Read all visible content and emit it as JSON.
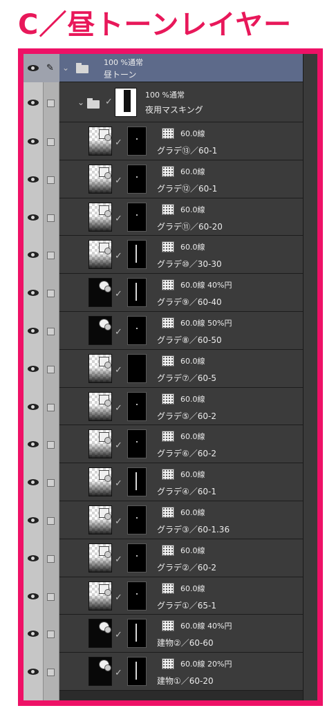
{
  "title": "C／昼トーンレイヤー",
  "top_folder": {
    "line1": "100 %通常",
    "line2": "昼トーン"
  },
  "sub_folder": {
    "line1": "100 %通常",
    "line2": "夜用マスキング"
  },
  "layers": [
    {
      "info": "60.0線",
      "name": "グラデ⑬／60-1",
      "thumb": "grad",
      "mask": "dot"
    },
    {
      "info": "60.0線",
      "name": "グラデ⑫／60-1",
      "thumb": "grad",
      "mask": "dot"
    },
    {
      "info": "60.0線",
      "name": "グラデ⑪／60-20",
      "thumb": "grad",
      "mask": "dot"
    },
    {
      "info": "60.0線",
      "name": "グラデ⑩／30-30",
      "thumb": "grad",
      "mask": "streak"
    },
    {
      "info": "60.0線 40%円",
      "name": "グラデ⑨／60-40",
      "thumb": "dark",
      "mask": "streak"
    },
    {
      "info": "60.0線 50%円",
      "name": "グラデ⑧／60-50",
      "thumb": "dark",
      "mask": "dot"
    },
    {
      "info": "60.0線",
      "name": "グラデ⑦／60-5",
      "thumb": "grad",
      "mask": "none"
    },
    {
      "info": "60.0線",
      "name": "グラデ⑤／60-2",
      "thumb": "grad",
      "mask": "dot"
    },
    {
      "info": "60.0線",
      "name": "グラデ⑥／60-2",
      "thumb": "grad",
      "mask": "dot"
    },
    {
      "info": "60.0線",
      "name": "グラデ④／60-1",
      "thumb": "grad",
      "mask": "streak"
    },
    {
      "info": "60.0線",
      "name": "グラデ③／60-1.36",
      "thumb": "grad",
      "mask": "dot"
    },
    {
      "info": "60.0線",
      "name": "グラデ②／60-2",
      "thumb": "grad",
      "mask": "dot"
    },
    {
      "info": "60.0線",
      "name": "グラデ①／65-1",
      "thumb": "grad",
      "mask": "dot"
    },
    {
      "info": "60.0線 40%円",
      "name": "建物②／60-60",
      "thumb": "dark",
      "mask": "streak"
    },
    {
      "info": "60.0線 20%円",
      "name": "建物①／60-20",
      "thumb": "dark",
      "mask": "streak"
    }
  ],
  "icons": {
    "eye": "eye-icon",
    "pen": "pen-icon",
    "folder": "folder-icon",
    "chevron": "chevron-down-icon",
    "check": "check-icon",
    "tone": "halftone-icon"
  },
  "colors": {
    "accent": "#ee1166",
    "title": "#e8185a",
    "panel": "#3b3b3b",
    "selected": "#5d6a8a"
  }
}
